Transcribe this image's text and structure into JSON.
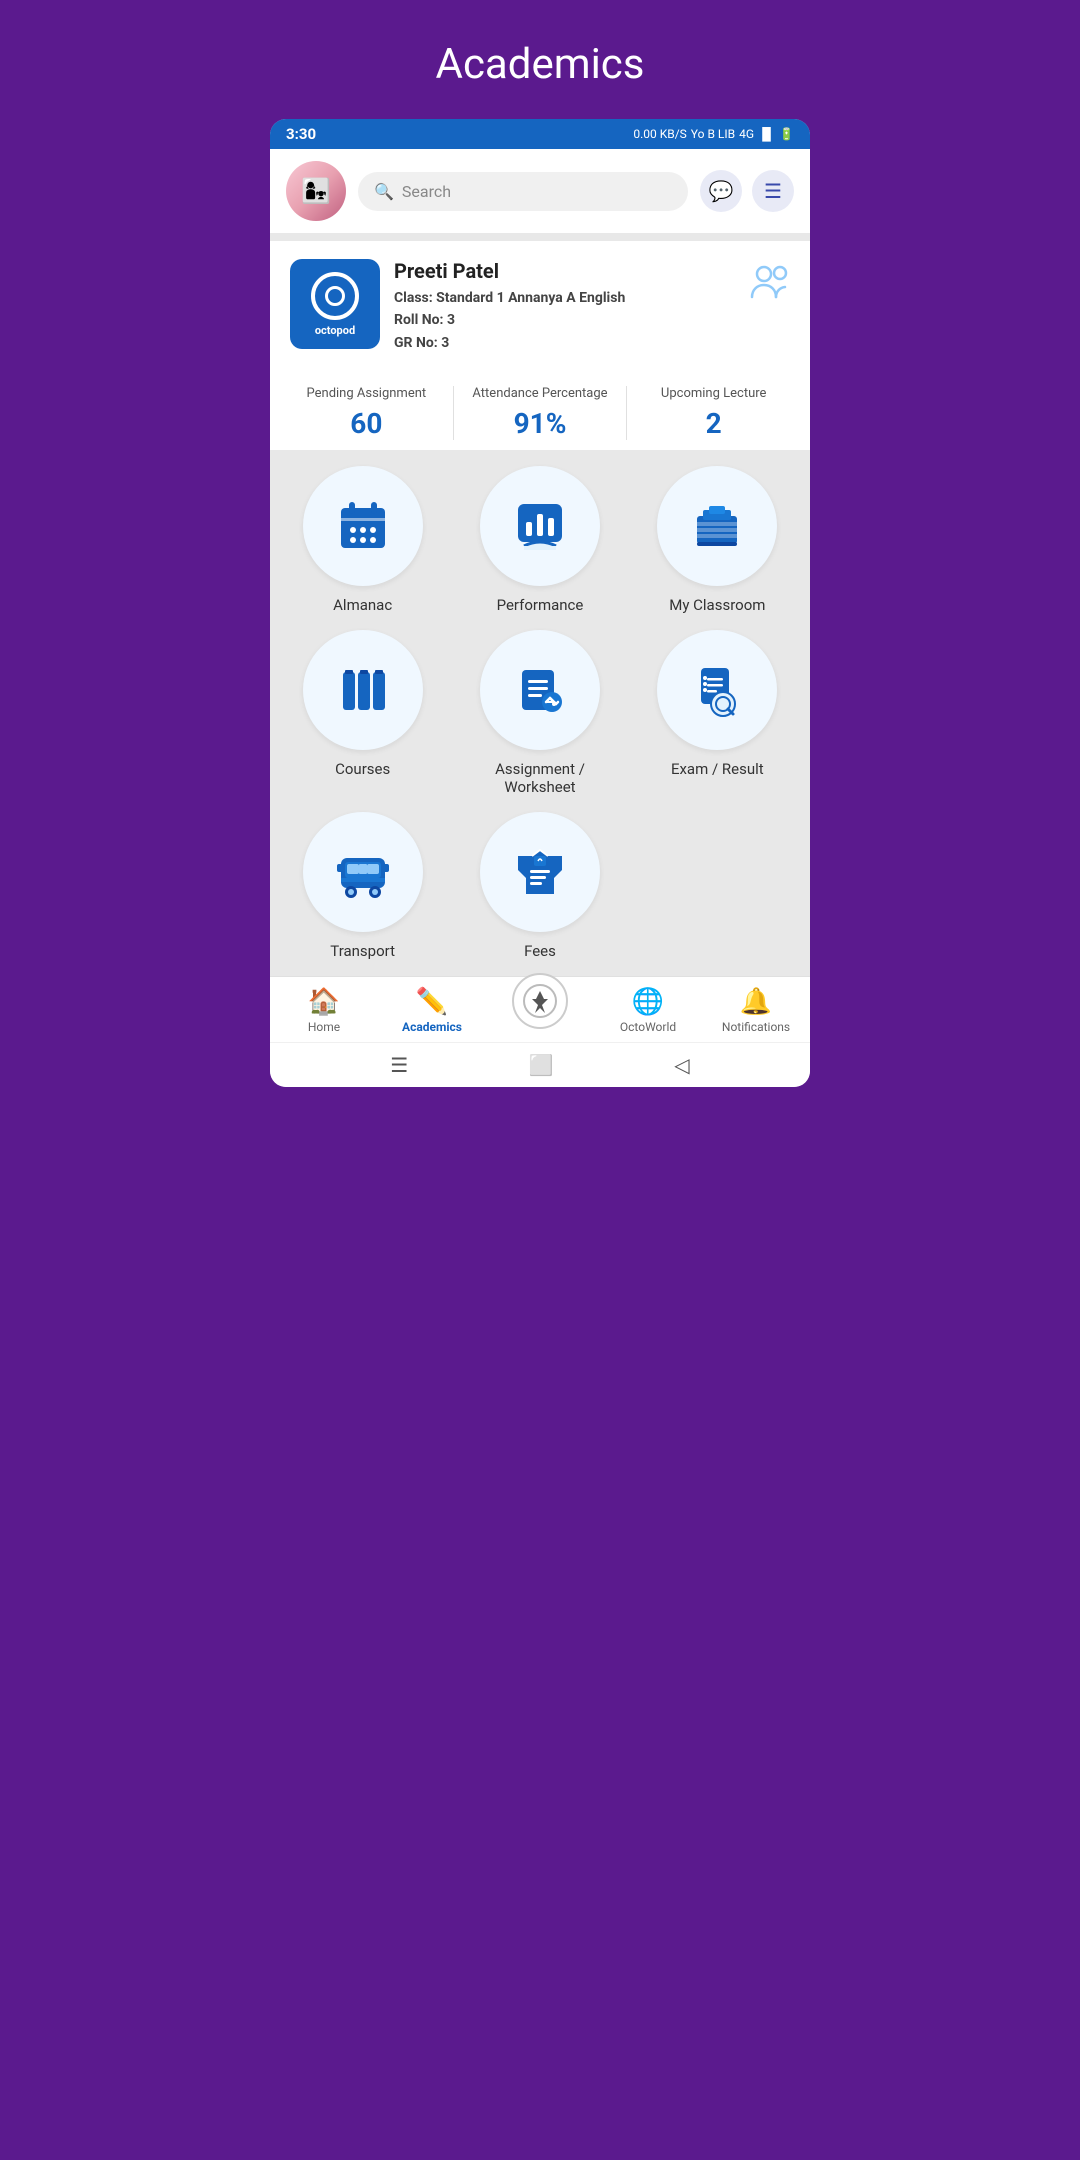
{
  "page": {
    "title": "Academics",
    "bg_color": "#5b1a8e"
  },
  "status_bar": {
    "time": "3:30",
    "network": "0.00 KB/S",
    "sim": "Yo B LIB",
    "signal": "4G"
  },
  "header": {
    "search_placeholder": "Search",
    "search_value": "0 Search"
  },
  "profile": {
    "logo_text": "octopod",
    "name": "Preeti Patel",
    "class_label": "Class:",
    "class_value": "Standard 1 Annanya A English",
    "roll_label": "Roll No:",
    "roll_value": "3",
    "gr_label": "GR No:",
    "gr_value": "3"
  },
  "stats": [
    {
      "label": "Pending Assignment",
      "value": "60"
    },
    {
      "label": "Attendance Percentage",
      "value": "91%"
    },
    {
      "label": "Upcoming Lecture",
      "value": "2"
    }
  ],
  "grid_items": [
    {
      "id": "almanac",
      "label": "Almanac"
    },
    {
      "id": "performance",
      "label": "Performance"
    },
    {
      "id": "my-classroom",
      "label": "My Classroom"
    },
    {
      "id": "courses",
      "label": "Courses"
    },
    {
      "id": "assignment-worksheet",
      "label": "Assignment / Worksheet"
    },
    {
      "id": "exam-result",
      "label": "Exam / Result"
    },
    {
      "id": "transport",
      "label": "Transport"
    },
    {
      "id": "fees",
      "label": "Fees"
    }
  ],
  "bottom_nav": [
    {
      "id": "home",
      "label": "Home",
      "active": false
    },
    {
      "id": "academics",
      "label": "Academics",
      "active": true
    },
    {
      "id": "octoworld-center",
      "label": "",
      "active": false
    },
    {
      "id": "octoworld",
      "label": "OctoWorld",
      "active": false
    },
    {
      "id": "notifications",
      "label": "Notifications",
      "active": false
    }
  ]
}
